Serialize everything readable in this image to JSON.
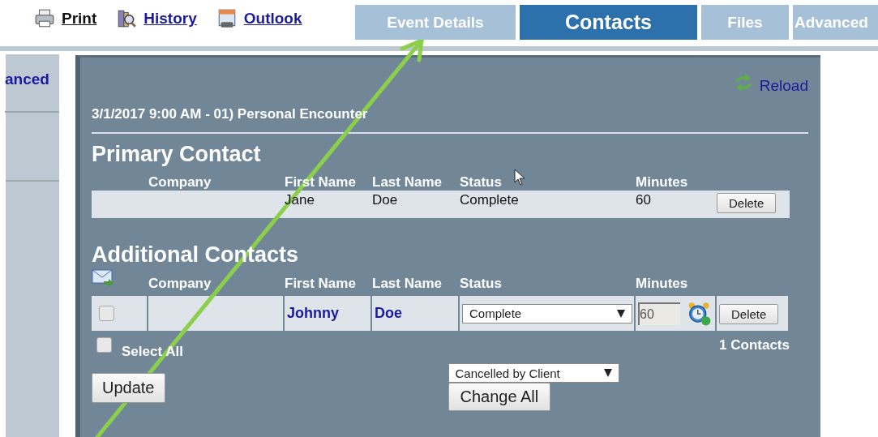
{
  "toolbar_links": [
    {
      "label": "Print",
      "kind": "printer"
    },
    {
      "label": "History",
      "kind": "history"
    },
    {
      "label": "Outlook",
      "kind": "calendar"
    }
  ],
  "tabs": [
    {
      "label": "Event Details",
      "selected": false
    },
    {
      "label": "Contacts",
      "selected": true
    },
    {
      "label": "Files",
      "selected": false
    },
    {
      "label": "Advanced",
      "selected": false
    }
  ],
  "sidebar": {
    "items": [
      "anced"
    ]
  },
  "panel": {
    "reload": "Reload",
    "event_title": "3/1/2017 9:00 AM - 01) Personal Encounter",
    "primary": {
      "heading": "Primary Contact",
      "columns": [
        "Company",
        "First Name",
        "Last Name",
        "Status",
        "Minutes"
      ],
      "row": {
        "first_name": "Jane",
        "last_name": "Doe",
        "status": "Complete",
        "minutes": "60",
        "delete": "Delete"
      }
    },
    "additional": {
      "heading": "Additional Contacts",
      "columns": [
        "Company",
        "First Name",
        "Last Name",
        "Status",
        "Minutes"
      ],
      "rows": [
        {
          "checked": false,
          "first_name": "Johnny",
          "last_name": "Doe",
          "status": "Complete",
          "minutes": "60",
          "delete": "Delete"
        }
      ],
      "select_all": {
        "label": "Select All",
        "checked": false
      },
      "count": "1 Contacts",
      "update": "Update",
      "bulk_status": "Cancelled by Client",
      "change_all": "Change All"
    }
  }
}
